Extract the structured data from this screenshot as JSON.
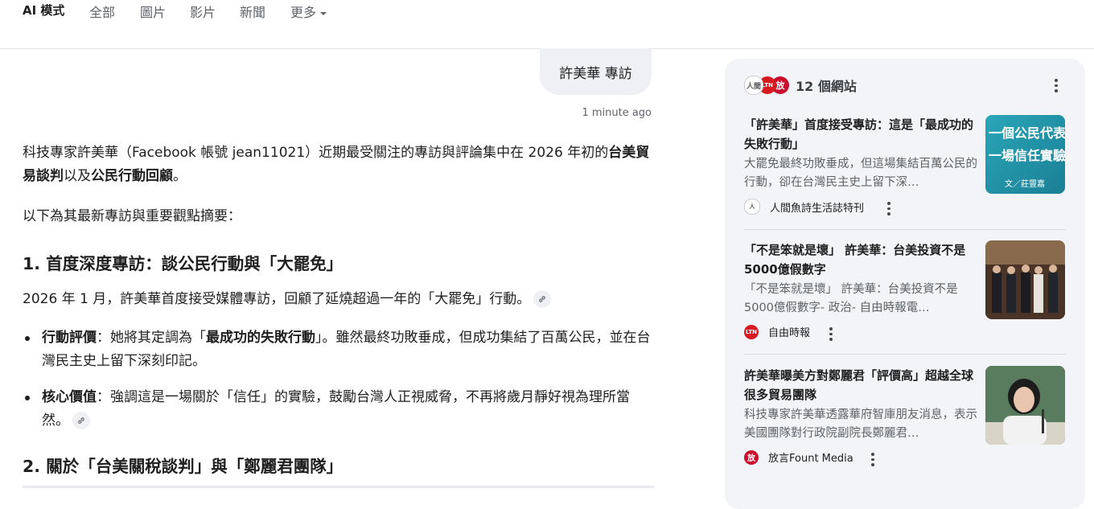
{
  "tabs": [
    {
      "label": "AI 模式",
      "active": true
    },
    {
      "label": "全部"
    },
    {
      "label": "圖片"
    },
    {
      "label": "影片"
    },
    {
      "label": "新聞"
    },
    {
      "label": "更多"
    }
  ],
  "query": {
    "text": "許美華 專訪",
    "timestamp": "1 minute ago"
  },
  "answer": {
    "p1_a": "科技專家許美華（Facebook 帳號 jean11021）近期最受關注的專訪與評論集中在 2026 年初的",
    "p1_b1": "台美貿易談判",
    "p1_c": "以及",
    "p1_b2": "公民行動回顧",
    "p1_d": "。",
    "p2": "以下為其最新專訪與重要觀點摘要：",
    "h1": "1. 首度深度專訪：談公民行動與「大罷免」",
    "p3": "2026 年 1 月，許美華首度接受媒體專訪，回顧了延燒超過一年的「大罷免」行動。",
    "li1_label": "行動評價",
    "li1_a": "：她將其定調為「",
    "li1_b": "最成功的失敗行動",
    "li1_c": "」。雖然最終功敗垂成，但成功集結了百萬公民，並在台灣民主史上留下深刻印記。",
    "li2_label": "核心價值",
    "li2_a": "：強調這是一場關於「信任」的實驗，鼓勵台灣人正視威脅，不再將歲月靜好視為理所當然。",
    "h2": "2. 關於「台美關稅談判」與「鄭麗君團隊」"
  },
  "sources": {
    "count_label": "12 個網站",
    "colors": {
      "ltn_red": "#d71920",
      "fount_red": "#c8102e"
    },
    "items": [
      {
        "title": "「許美華」首度接受專訪：這是「最成功的失敗行動」",
        "snippet": "大罷免最終功敗垂成，但這場集結百萬公民的行動，卻在台灣民主史上留下深…",
        "source": "人間魚詩生活誌特刊",
        "thumb_line1": "一個公民代表",
        "thumb_line2": "一場信任實驗",
        "thumb_credit": "文／莊豐嘉"
      },
      {
        "title": "「不是笨就是壞」 許美華：台美投資不是5000億假數字",
        "snippet": "「不是笨就是壞」 許美華：台美投資不是5000億假數字- 政治- 自由時報電…",
        "source": "自由時報"
      },
      {
        "title": "許美華曝美方對鄭麗君「評價高」超越全球很多貿易團隊",
        "snippet": "科技專家許美華透露華府智庫朋友消息，表示美國團隊對行政院副院長鄭麗君…",
        "source": "放言Fount Media"
      }
    ]
  }
}
